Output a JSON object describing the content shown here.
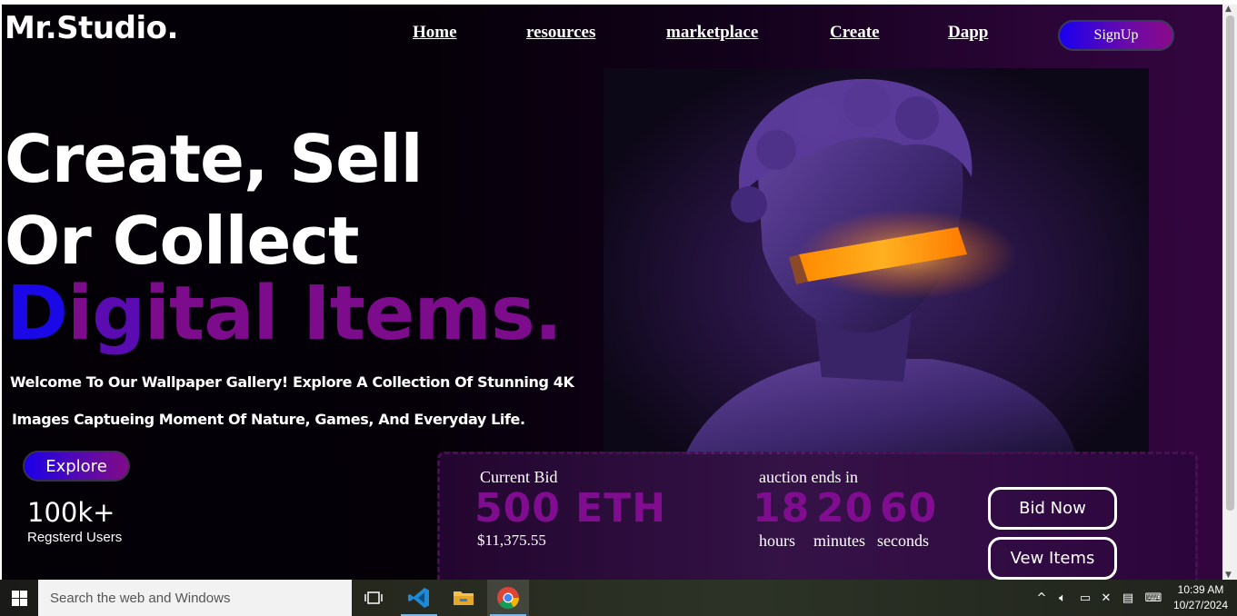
{
  "site": {
    "logo": "Mr.Studio.",
    "nav": [
      {
        "label": "Home"
      },
      {
        "label": "resources"
      },
      {
        "label": "marketplace"
      },
      {
        "label": "Create"
      },
      {
        "label": "Dapp"
      }
    ],
    "signup_label": "SignUp"
  },
  "hero": {
    "line1": "Create, Sell",
    "line2": "Or Collect",
    "line3_first": "D",
    "line3_g": "g",
    "line3_rest_a": "i",
    "line3_rest_b": "ital Items.",
    "desc_line1": "Welcome To Our Wallpaper Gallery! Explore A Collection Of Stunning 4K",
    "desc_line2": "Images Captueing Moment Of Nature, Games, And Everyday Life.",
    "explore_label": "Explore",
    "stat_value": "100k+",
    "stat_label": "Regsterd Users"
  },
  "auction": {
    "current_bid_label": "Current Bid",
    "bid_value": "500 ETH",
    "bid_usd": "$11,375.55",
    "ends_label": "auction ends in",
    "hours": "18",
    "minutes": "20",
    "seconds": "60",
    "hours_label": "hours",
    "minutes_label": "minutes",
    "seconds_label": "seconds",
    "bid_now_label": "Bid Now",
    "view_items_label": "Vew Items"
  },
  "taskbar": {
    "search_placeholder": "Search the web and Windows",
    "time": "10:39 AM",
    "date": "10/27/2024"
  },
  "colors": {
    "accent_blue": "#1a08e6",
    "accent_purple": "#800d8f",
    "background": "#030006"
  }
}
